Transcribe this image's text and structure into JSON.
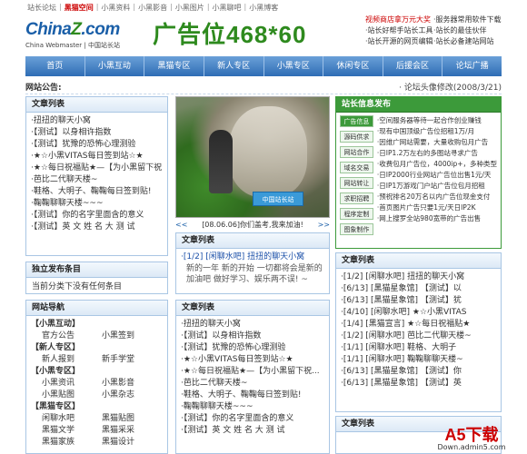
{
  "top_links": [
    "站长论坛",
    "黑猫空间",
    "小黑资料",
    "小黑影音",
    "小黑图片",
    "小黑聊吧",
    "小黑博客"
  ],
  "header": {
    "logo_text": "China",
    "logo_z": "Z",
    "logo_suffix": ".com",
    "logo_sub": "China Webmaster | 中国站长站",
    "ad_text": "广告位468*60",
    "promo": [
      [
        "视频商店拿万元大奖",
        "·服务器常用软件下载"
      ],
      [
        "·站长好帮手站长工具",
        "·站长的最佳伙伴"
      ],
      [
        "·站长开源的网页编辑器",
        "·站长必备建站网站"
      ]
    ]
  },
  "nav": [
    "首页",
    "小黑互动",
    "黑猫专区",
    "新人专区",
    "小黑专区",
    "休闲专区",
    "后援会区",
    "论坛广播"
  ],
  "notice": {
    "label": "网站公告:",
    "tail": "· 论坛头像修改(2008/3/21)"
  },
  "left_articles": {
    "title": "文章列表",
    "items": [
      "·扭扭的聊天小窝",
      "·【测试】以身相许指数",
      "·【测试】犹豫的恐怖心理测验",
      "·★☆小黑VITAS每日签到站☆★",
      "·★☆每日祝福贴★—【为小黑留下祝",
      "·芭比二代聊天楼~",
      "·鞋格、大明子、鞠鞠每日签到贴!",
      "·鞠鞠聊聊天楼~~~",
      "·【测试】你的名字里面含的意义",
      "·【测试】英 文 姓 名 大 测 试"
    ]
  },
  "left_publish": {
    "title": "独立发布条目",
    "text": "当前分类下没有任何条目"
  },
  "left_nav": {
    "title": "网站导航",
    "groups": [
      {
        "name": "【小黑互动】",
        "pairs": [
          [
            "官方公告",
            "小黑签到"
          ]
        ]
      },
      {
        "name": "【新人专区】",
        "pairs": [
          [
            "新人报到",
            "新手学堂"
          ]
        ]
      },
      {
        "name": "【小黑专区】",
        "pairs": [
          [
            "小黑资讯",
            "小黑影音"
          ],
          [
            "小黑贴图",
            "小黑杂志"
          ]
        ]
      },
      {
        "name": "【黑猫专区】",
        "pairs": [
          [
            "闲聊水吧",
            "黑猫贴图"
          ],
          [
            "黑猫文学",
            "黑猫采采"
          ],
          [
            "黑猫家族",
            "黑猫设计"
          ]
        ]
      }
    ]
  },
  "slideshow": {
    "tag": "中国站长站",
    "prev": "<<",
    "caption": "[08.06.06]你们盖考,我来加油!",
    "next": ">>"
  },
  "mid_articles_a": {
    "title": "文章列表",
    "items": [
      "·[1/2] [闲聊水吧] 扭扭的聊天小窝",
      "新的一年 新的开始 一切都将会是新的 加油吧 做好学习、娱乐两不误! ~"
    ]
  },
  "mid_articles_b": {
    "title": "文章列表",
    "items": [
      "·扭扭的聊天小窝",
      "·【测试】以身相许指数",
      "·【测试】犹豫的恐怖心理测验",
      "·★☆小黑VITAS每日签到站☆★",
      "·★☆每日祝福贴★—【为小黑留下祝...",
      "·芭比二代聊天楼~",
      "·鞋格、大明子、鞠鞠每日签到贴!",
      "·鞠鞠聊聊天楼~~~",
      "·【测试】你的名字里面含的意义",
      "·【测试】英 文 姓 名 大 测 试"
    ]
  },
  "info_box": {
    "title": "站长信息发布",
    "tabs": [
      "广告信息",
      "源码供求",
      "网站合作",
      "域名交易",
      "网站转让",
      "求职招聘",
      "程序定制",
      "图象制作"
    ],
    "items": [
      "·空间服务器等待一起合作创业赚钱",
      "·现有中国顶级广告位招租1万/月",
      "·因维广网站需要，大量收购包月广告",
      "·日IP1.2万左右的多图站寻求广告",
      "·收费包月广告位，4000ip+，多种类型",
      "·日IP2000行业网站广告位出售1元/天",
      "·日IP1万游戏门户站广告位包月招租",
      "·预祝排名20万名以内广告位现金支付",
      "·首页图片广告只要1元/天日IP2K",
      "·网上搜罗全站980宽带的广告出售"
    ]
  },
  "right_articles": {
    "title": "文章列表",
    "items": [
      "·[1/2] [闲聊水吧] 扭扭的聊天小窝",
      "·[6/13] [黑猫星象馆] 【测试】以",
      "·[6/13] [黑猫星象馆] 【测试】犹",
      "·[4/10] [闲聊水吧] ★☆小黑VITAS",
      "·[1/4] [黑猫宣言] ★☆每日祝福贴★",
      "·[1/2] [闲聊水吧] 芭比二代聊天楼~",
      "·[1/1] [闲聊水吧] 鞋格、大明子",
      "·[1/1] [闲聊水吧] 鞠鞠聊聊天楼~",
      "·[6/13] [黑猫星象馆] 【测试】你",
      "·[6/13] [黑猫星象馆] 【测试】英"
    ]
  },
  "right_articles_2": {
    "title": "文章列表"
  },
  "watermark": {
    "big": "A5下载",
    "small": "Down.admin5.com"
  }
}
